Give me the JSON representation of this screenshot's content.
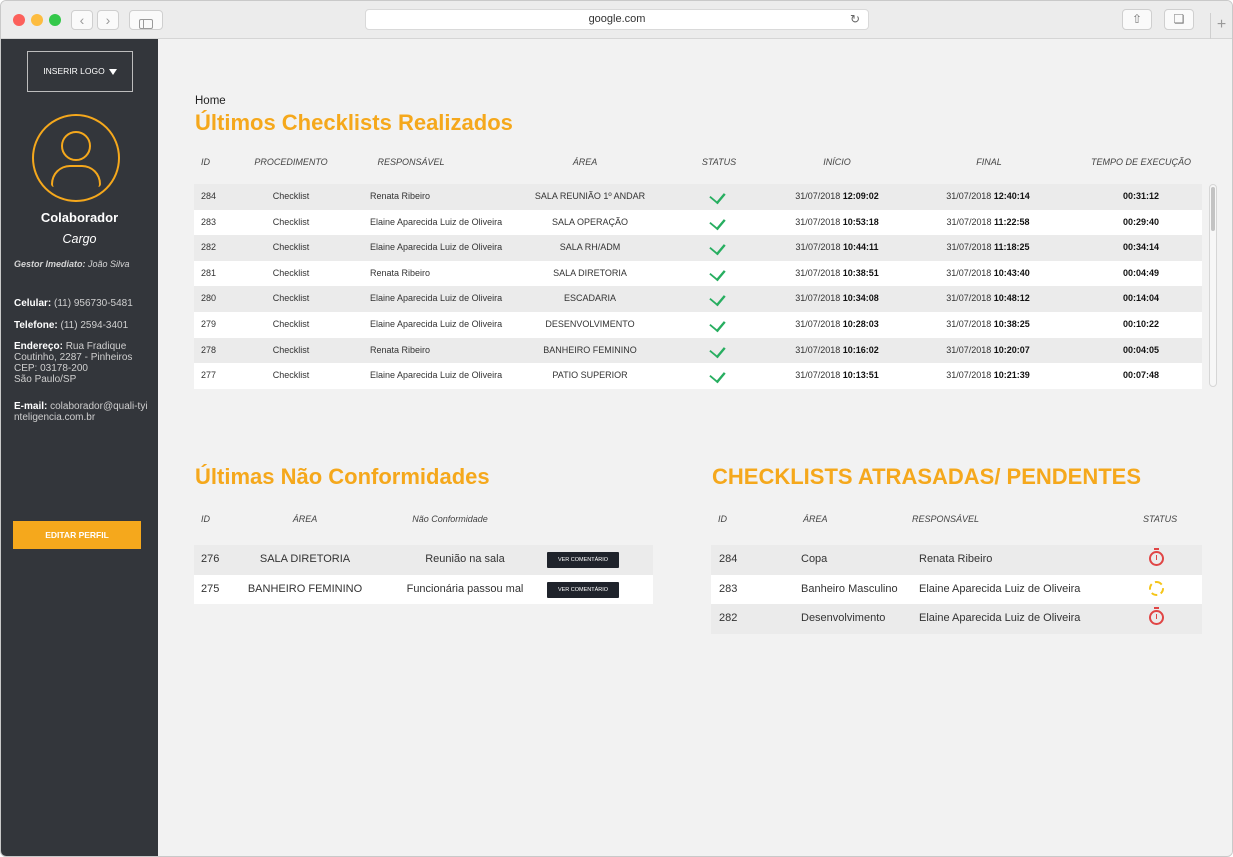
{
  "browser": {
    "url": "google.com",
    "back_icon": "chevron-left-icon",
    "forward_icon": "chevron-right-icon",
    "sidebar_icon": "sidebar-icon",
    "reload_icon": "reload-icon",
    "share_icon": "share-icon",
    "tabs_icon": "tabs-icon",
    "new_tab_icon": "plus-icon"
  },
  "sidebar": {
    "logo_button": "INSERIR LOGO",
    "name": "Colaborador",
    "cargo": "Cargo",
    "gestor_label": "Gestor Imediato:",
    "gestor_value": "João Silva",
    "celular_label": "Celular:",
    "celular_value": "(11) 956730-5481",
    "telefone_label": "Telefone:",
    "telefone_value": "(11) 2594-3401",
    "endereco_label": "Endereço:",
    "endereco_value": "Rua Fradique Coutinho, 2287 - Pinheiros",
    "cep": "CEP: 03178-200",
    "cidade": "São Paulo/SP",
    "email_label": "E-mail:",
    "email_value": "colaborador@quali-tyinteligencia.com.br",
    "edit_button": "EDITAR PERFIL"
  },
  "main": {
    "breadcrumb": "Home",
    "checklists": {
      "title": "Últimos Checklists Realizados",
      "headers": [
        "ID",
        "PROCEDIMENTO",
        "RESPONSÁVEL",
        "ÁREA",
        "STATUS",
        "INÍCIO",
        "FINAL",
        "TEMPO DE EXECUÇÃO"
      ],
      "rows": [
        {
          "id": "284",
          "proc": "Checklist",
          "resp": "Renata Ribeiro",
          "area": "SALA REUNIÃO 1º ANDAR",
          "status": "check-icon",
          "inicio_data": "31/07/2018",
          "inicio_hora": "12:09:02",
          "final_data": "31/07/2018",
          "final_hora": "12:40:14",
          "tempo": "00:31:12"
        },
        {
          "id": "283",
          "proc": "Checklist",
          "resp": "Elaine Aparecida Luiz de Oliveira",
          "area": "SALA OPERAÇÃO",
          "status": "check-icon",
          "inicio_data": "31/07/2018",
          "inicio_hora": "10:53:18",
          "final_data": "31/07/2018",
          "final_hora": "11:22:58",
          "tempo": "00:29:40"
        },
        {
          "id": "282",
          "proc": "Checklist",
          "resp": "Elaine Aparecida Luiz de Oliveira",
          "area": "SALA RH/ADM",
          "status": "check-icon",
          "inicio_data": "31/07/2018",
          "inicio_hora": "10:44:11",
          "final_data": "31/07/2018",
          "final_hora": "11:18:25",
          "tempo": "00:34:14"
        },
        {
          "id": "281",
          "proc": "Checklist",
          "resp": "Renata Ribeiro",
          "area": "SALA DIRETORIA",
          "status": "check-icon",
          "inicio_data": "31/07/2018",
          "inicio_hora": "10:38:51",
          "final_data": "31/07/2018",
          "final_hora": "10:43:40",
          "tempo": "00:04:49"
        },
        {
          "id": "280",
          "proc": "Checklist",
          "resp": "Elaine Aparecida Luiz de Oliveira",
          "area": "ESCADARIA",
          "status": "check-icon",
          "inicio_data": "31/07/2018",
          "inicio_hora": "10:34:08",
          "final_data": "31/07/2018",
          "final_hora": "10:48:12",
          "tempo": "00:14:04"
        },
        {
          "id": "279",
          "proc": "Checklist",
          "resp": "Elaine Aparecida Luiz de Oliveira",
          "area": "DESENVOLVIMENTO",
          "status": "check-icon",
          "inicio_data": "31/07/2018",
          "inicio_hora": "10:28:03",
          "final_data": "31/07/2018",
          "final_hora": "10:38:25",
          "tempo": "00:10:22"
        },
        {
          "id": "278",
          "proc": "Checklist",
          "resp": "Renata Ribeiro",
          "area": "BANHEIRO FEMININO",
          "status": "check-icon",
          "inicio_data": "31/07/2018",
          "inicio_hora": "10:16:02",
          "final_data": "31/07/2018",
          "final_hora": "10:20:07",
          "tempo": "00:04:05"
        },
        {
          "id": "277",
          "proc": "Checklist",
          "resp": "Elaine Aparecida Luiz de Oliveira",
          "area": "PATIO SUPERIOR",
          "status": "check-icon",
          "inicio_data": "31/07/2018",
          "inicio_hora": "10:13:51",
          "final_data": "31/07/2018",
          "final_hora": "10:21:39",
          "tempo": "00:07:48"
        }
      ]
    },
    "nao_conformidades": {
      "title": "Últimas Não Conformidades",
      "headers": [
        "ID",
        "ÁREA",
        "Não Conformidade"
      ],
      "rows": [
        {
          "id": "276",
          "area": "SALA DIRETORIA",
          "desc": "Reunião na sala",
          "button": "VER COMENTÁRIO"
        },
        {
          "id": "275",
          "area": "BANHEIRO FEMININO",
          "desc": "Funcionária passou mal",
          "button": "VER COMENTÁRIO"
        }
      ]
    },
    "atrasadas": {
      "title": "CHECKLISTS ATRASADAS/ PENDENTES",
      "headers": [
        "ID",
        "ÁREA",
        "RESPONSÁVEL",
        "STATUS"
      ],
      "rows": [
        {
          "id": "284",
          "area": "Copa",
          "resp": "Renata Ribeiro",
          "status": "timer-icon-late"
        },
        {
          "id": "283",
          "area": "Banheiro Masculino",
          "resp": "Elaine Aparecida Luiz de Oliveira",
          "status": "timer-icon-pending"
        },
        {
          "id": "282",
          "area": "Desenvolvimento",
          "resp": "Elaine Aparecida Luiz de Oliveira",
          "status": "timer-icon-late"
        }
      ]
    }
  },
  "colors": {
    "accent": "#f5a81c",
    "sidebar_bg": "#33363b",
    "check": "#27ae60",
    "late": "#e04545",
    "pending": "#f5c518"
  }
}
